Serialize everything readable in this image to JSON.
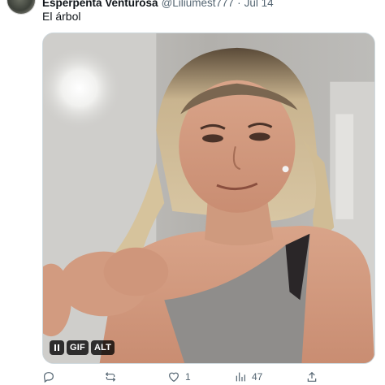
{
  "tweet": {
    "display_name": "Esperpenta Venturosa",
    "handle": "@Liliumest777",
    "separator": "·",
    "date": "Jul 14",
    "text": "El árbol"
  },
  "media": {
    "type": "gif",
    "badges": {
      "gif_label": "GIF",
      "alt_label": "ALT"
    }
  },
  "actions": {
    "replies": {
      "icon": "reply-icon",
      "count": ""
    },
    "retweets": {
      "icon": "retweet-icon",
      "count": ""
    },
    "likes": {
      "icon": "heart-icon",
      "count": "1"
    },
    "views": {
      "icon": "views-chart-icon",
      "count": "47"
    },
    "share": {
      "icon": "share-icon"
    }
  },
  "colors": {
    "text_primary": "#0f1419",
    "text_secondary": "#536471",
    "border": "#cfd9de"
  }
}
